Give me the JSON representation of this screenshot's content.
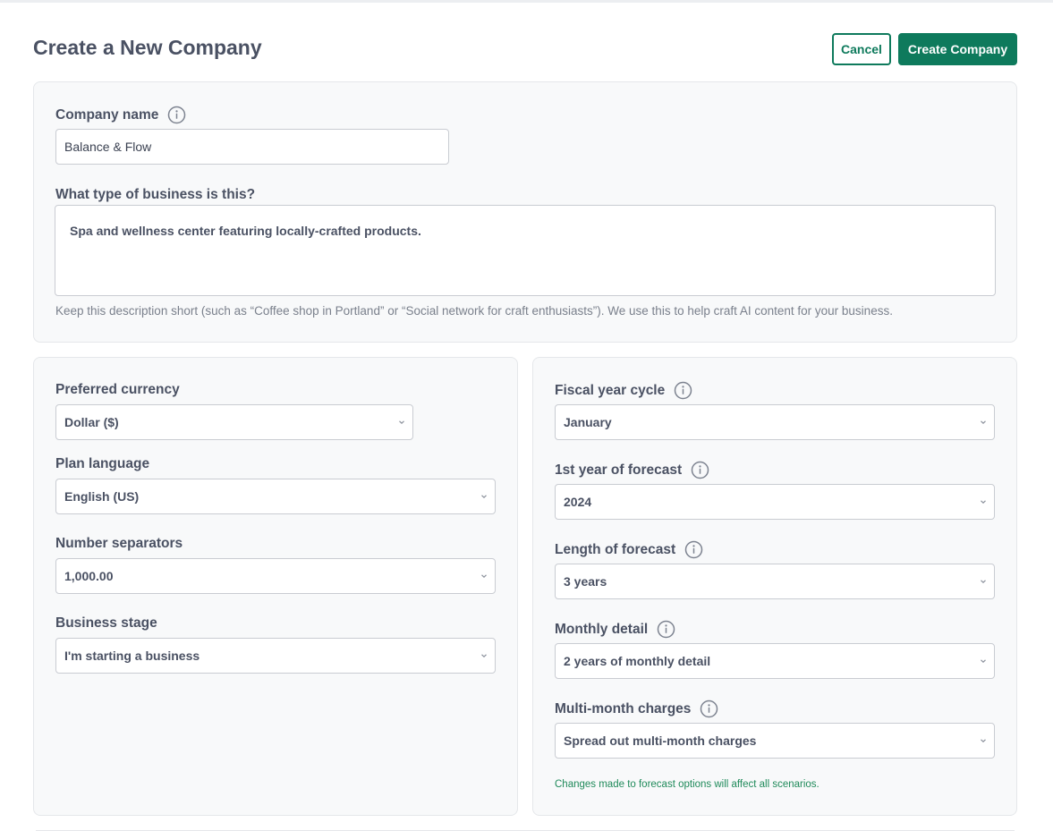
{
  "header": {
    "title": "Create a New Company",
    "cancel_label": "Cancel",
    "create_label": "Create Company"
  },
  "company": {
    "name_label": "Company name",
    "name_value": "Balance & Flow",
    "business_type_label": "What type of business is this?",
    "business_type_value": "Spa and wellness center featuring locally-crafted products.",
    "business_type_hint": "Keep this description short (such as “Coffee shop in Portland” or “Social network for craft enthusiasts”). We use this to help craft AI content for your business."
  },
  "settings": {
    "currency_label": "Preferred currency",
    "currency_value": "Dollar ($)",
    "language_label": "Plan language",
    "language_value": "English (US)",
    "separators_label": "Number separators",
    "separators_value": "1,000.00",
    "stage_label": "Business stage",
    "stage_value": "I'm starting a business"
  },
  "forecast": {
    "fiscal_label": "Fiscal year cycle",
    "fiscal_value": "January",
    "first_year_label": "1st year of forecast",
    "first_year_value": "2024",
    "length_label": "Length of forecast",
    "length_value": "3 years",
    "monthly_label": "Monthly detail",
    "monthly_value": "2 years of monthly detail",
    "multimonth_label": "Multi-month charges",
    "multimonth_value": "Spread out multi-month charges",
    "note": "Changes made to forecast options will affect all scenarios."
  },
  "colors": {
    "accent": "#0e7a5c",
    "note_green": "#1f8a5a",
    "card_bg": "#f8f9fa",
    "text": "#4a5163"
  },
  "icons": {
    "info": "info-circle-icon",
    "dropdown": "chevron-down-icon"
  }
}
